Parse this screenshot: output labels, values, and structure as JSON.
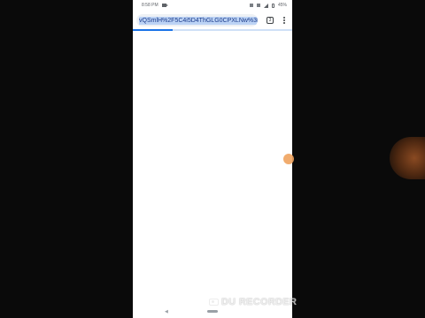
{
  "status_bar": {
    "time": "8:58 PM",
    "battery": "45%"
  },
  "browser": {
    "url": "vQSmlH%2F5C4i5D4ThGLG0CPXLNw%3D%",
    "tab_count": "3",
    "load_progress_percent": 25
  },
  "nav": {
    "back_glyph": "◀"
  },
  "watermark": {
    "text": "DU RECORDER"
  },
  "colors": {
    "accent": "#1a73e8",
    "url_highlight": "#bcd3f5",
    "bubble": "#f0a35e"
  },
  "icons": [
    "camera-icon",
    "signal-icon",
    "battery-icon",
    "tabs-icon",
    "more-vert-icon",
    "home-pill-icon",
    "recorder-camera-icon"
  ]
}
